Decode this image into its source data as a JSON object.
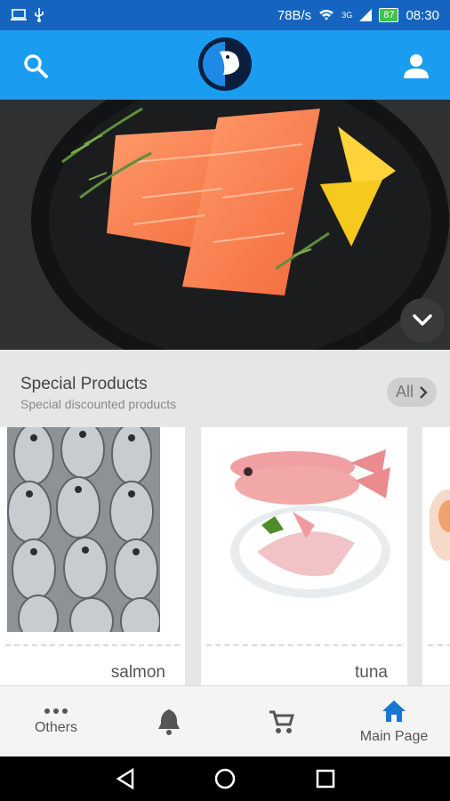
{
  "status": {
    "speed": "78B/s",
    "signal": "3G",
    "battery": "87",
    "time": "08:30"
  },
  "header": {
    "search_icon": "search-icon",
    "logo": "penguin-logo",
    "profile_icon": "person-icon"
  },
  "hero": {
    "image": "salmon-fillets-in-pan",
    "expand_icon": "chevron-down-icon"
  },
  "special": {
    "title": "Special Products",
    "subtitle": "Special discounted products",
    "all_label": "All",
    "products": [
      {
        "name": "salmon"
      },
      {
        "name": "tuna"
      }
    ]
  },
  "nav": {
    "others": "Others",
    "notifications_icon": "bell-icon",
    "cart_icon": "cart-icon",
    "home": "Main Page"
  }
}
